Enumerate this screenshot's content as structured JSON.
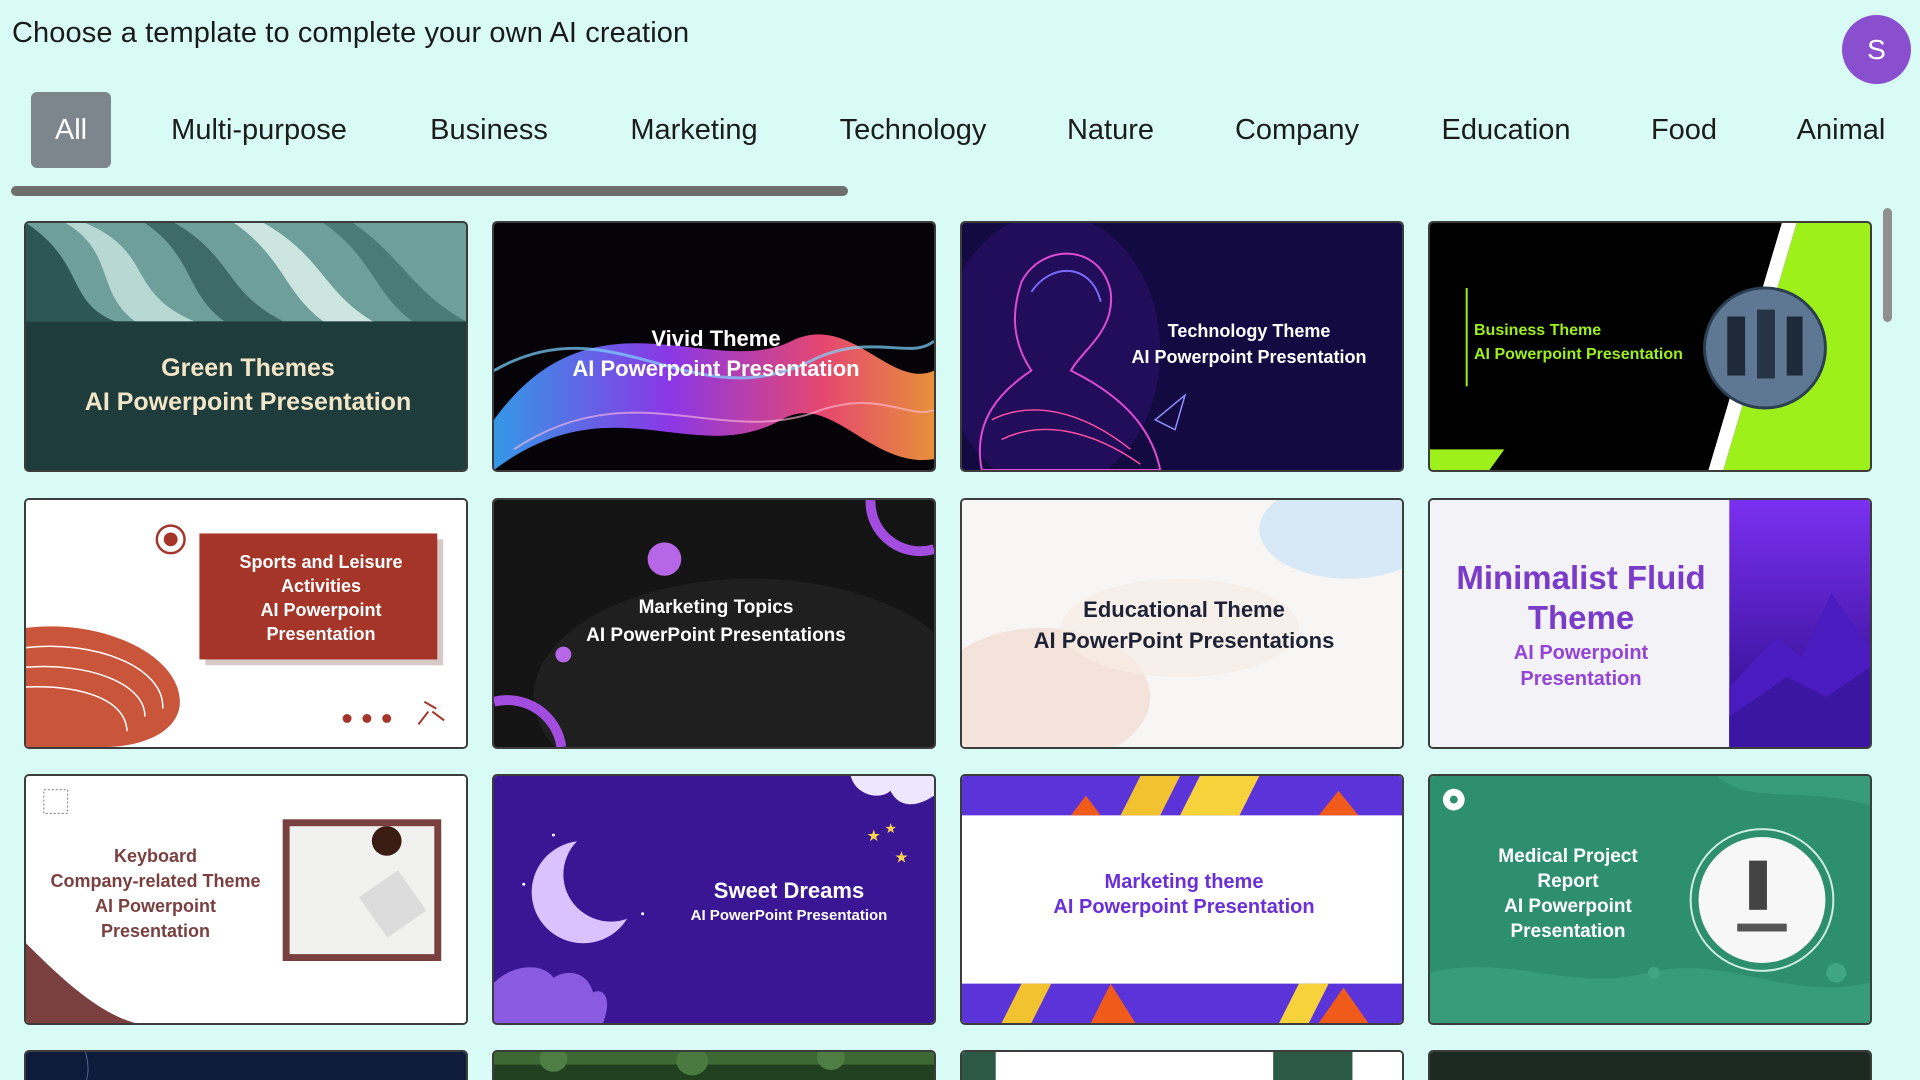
{
  "header": {
    "title": "Choose a template to complete your own AI creation",
    "avatar_initial": "S"
  },
  "tabs": [
    {
      "label": "All",
      "active": true
    },
    {
      "label": "Multi-purpose"
    },
    {
      "label": "Business"
    },
    {
      "label": "Marketing"
    },
    {
      "label": "Technology"
    },
    {
      "label": "Nature"
    },
    {
      "label": "Company"
    },
    {
      "label": "Education"
    },
    {
      "label": "Food"
    },
    {
      "label": "Animal"
    }
  ],
  "templates": [
    {
      "line1": "Green Themes",
      "line2": "AI Powerpoint Presentation"
    },
    {
      "line1": "Vivid Theme",
      "line2": "AI Powerpoint Presentation"
    },
    {
      "line1": "Technology Theme",
      "line2": "AI Powerpoint Presentation"
    },
    {
      "line1": "Business Theme",
      "line2": "AI Powerpoint Presentation"
    },
    {
      "line1": "Sports and Leisure",
      "line2": "Activities",
      "line3": "AI Powerpoint",
      "line4": "Presentation"
    },
    {
      "line1": "Marketing Topics",
      "line2": "AI PowerPoint Presentations"
    },
    {
      "line1": "Educational Theme",
      "line2": "AI PowerPoint Presentations"
    },
    {
      "line1": "Minimalist Fluid",
      "line2": "Theme",
      "line3": "AI Powerpoint",
      "line4": "Presentation"
    },
    {
      "line1": "Keyboard",
      "line2": "Company-related Theme",
      "line3": "AI Powerpoint",
      "line4": "Presentation"
    },
    {
      "line1": "Sweet Dreams",
      "line2": "AI PowerPoint Presentation"
    },
    {
      "line1": "Marketing theme",
      "line2": "AI Powerpoint Presentation"
    },
    {
      "line1": "Medical Project",
      "line2": "Report",
      "line3": "AI Powerpoint",
      "line4": "Presentation"
    }
  ],
  "colors": {
    "background": "#d9fbf5",
    "active_tab": "#7d868c",
    "avatar": "#8a4fcf"
  }
}
